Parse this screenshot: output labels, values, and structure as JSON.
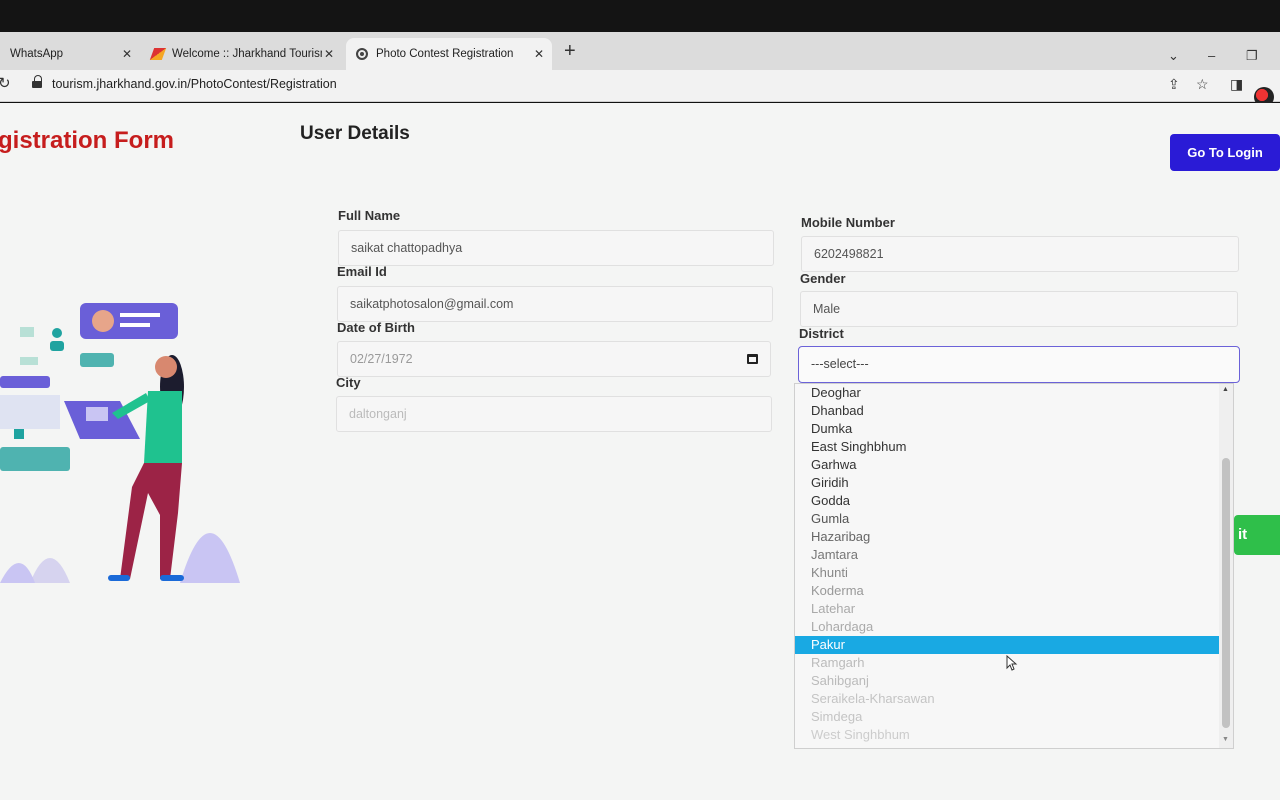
{
  "browser": {
    "tabs": [
      {
        "label": "WhatsApp"
      },
      {
        "label": "Welcome :: Jharkhand Tourism D"
      },
      {
        "label": "Photo Contest Registration"
      }
    ],
    "url": "tourism.jharkhand.gov.in/PhotoContest/Registration"
  },
  "page": {
    "form_title": "gistration Form",
    "section_title": "User Details",
    "login_button": "Go To Login",
    "submit_fragment": "it"
  },
  "form": {
    "full_name": {
      "label": "Full Name",
      "value": "saikat chattopadhya"
    },
    "email": {
      "label": "Email Id",
      "value": "saikatphotosalon@gmail.com"
    },
    "dob": {
      "label": "Date of Birth",
      "value": "02/27/1972"
    },
    "city": {
      "label": "City",
      "value": "daltonganj"
    },
    "mobile": {
      "label": "Mobile Number",
      "value": "6202498821"
    },
    "gender": {
      "label": "Gender",
      "value": "Male"
    },
    "district": {
      "label": "District",
      "value": "---select---",
      "options": [
        "Deoghar",
        "Dhanbad",
        "Dumka",
        "East Singhbhum",
        "Garhwa",
        "Giridih",
        "Godda",
        "Gumla",
        "Hazaribag",
        "Jamtara",
        "Khunti",
        "Koderma",
        "Latehar",
        "Lohardaga",
        "Pakur",
        "Ramgarh",
        "Sahibganj",
        "Seraikela-Kharsawan",
        "Simdega",
        "West Singhbhum"
      ],
      "highlighted": "Pakur"
    }
  },
  "colors": {
    "title_red": "#c61d1d",
    "button_blue": "#2a1bd6",
    "highlight_blue": "#19a9e3",
    "submit_green": "#2fbf4a"
  }
}
